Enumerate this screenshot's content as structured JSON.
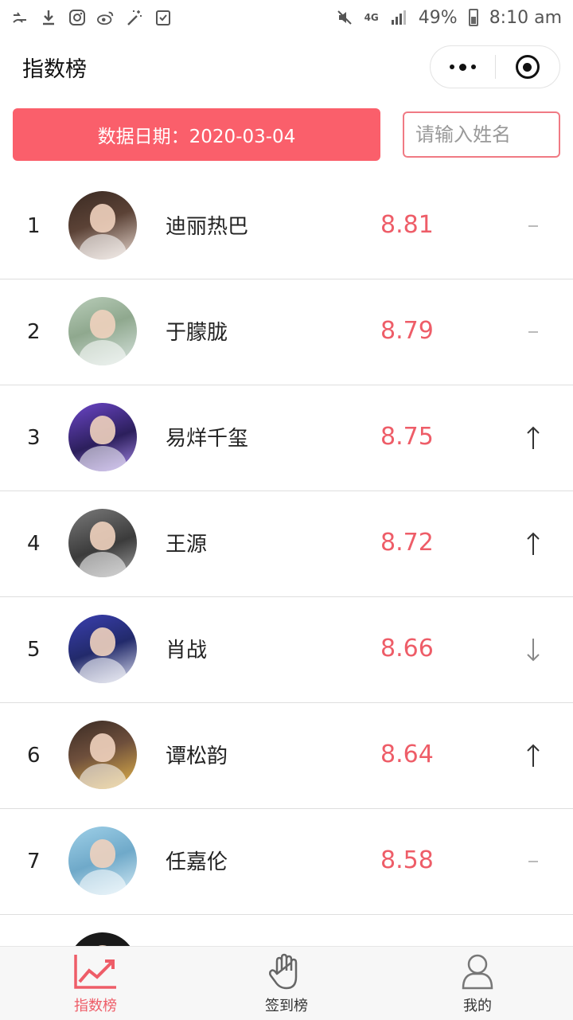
{
  "status_bar": {
    "time": "8:10 am",
    "battery": "49%",
    "network": "4G",
    "left_icons": [
      "swap-icon",
      "download-icon",
      "instagram-icon",
      "weibo-icon",
      "magic-wand-icon",
      "task-check-icon"
    ],
    "right_icons": [
      "mute-icon",
      "network-4g-icon",
      "signal-icon",
      "battery-icon"
    ]
  },
  "header": {
    "title": "指数榜"
  },
  "filter": {
    "date_label": "数据日期：2020-03-04",
    "search_placeholder": "请输入姓名"
  },
  "accent_color": "#fa5f6b",
  "list": {
    "rows": [
      {
        "rank": "1",
        "name": "迪丽热巴",
        "score": "8.81",
        "trend": "same"
      },
      {
        "rank": "2",
        "name": "于朦胧",
        "score": "8.79",
        "trend": "same"
      },
      {
        "rank": "3",
        "name": "易烊千玺",
        "score": "8.75",
        "trend": "up"
      },
      {
        "rank": "4",
        "name": "王源",
        "score": "8.72",
        "trend": "up"
      },
      {
        "rank": "5",
        "name": "肖战",
        "score": "8.66",
        "trend": "down"
      },
      {
        "rank": "6",
        "name": "谭松韵",
        "score": "8.64",
        "trend": "up"
      },
      {
        "rank": "7",
        "name": "任嘉伦",
        "score": "8.58",
        "trend": "same"
      }
    ]
  },
  "tabbar": {
    "tabs": [
      {
        "label": "指数榜",
        "icon": "trend-chart-icon",
        "active": true
      },
      {
        "label": "签到榜",
        "icon": "hand-icon",
        "active": false
      },
      {
        "label": "我的",
        "icon": "user-icon",
        "active": false
      }
    ]
  }
}
